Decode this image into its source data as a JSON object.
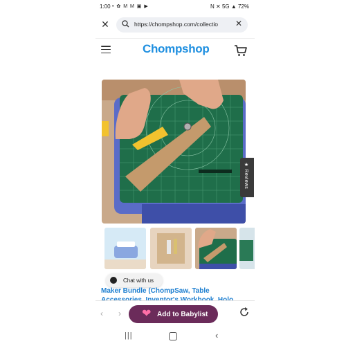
{
  "status": {
    "time": "1:00",
    "notifications": "• ✿ M M ▣ ▶",
    "right": "N ✕ 5G ▲ 72%"
  },
  "browser": {
    "url": "https://chompshop.com/collectio"
  },
  "header": {
    "logo": "Chompshop"
  },
  "reviews_tab": {
    "label": "★ Reviews"
  },
  "chat": {
    "label": "Chat with us"
  },
  "product": {
    "title": "Maker Bundle (ChompSaw, Table Accessories, Inventor's Workbook, Holo"
  },
  "bottom": {
    "babylist_label": "Add to Babylist"
  },
  "colors": {
    "brand": "#1e8fe0",
    "babylist_bg": "#6b2b5a",
    "mat": "#1f6e4a"
  }
}
